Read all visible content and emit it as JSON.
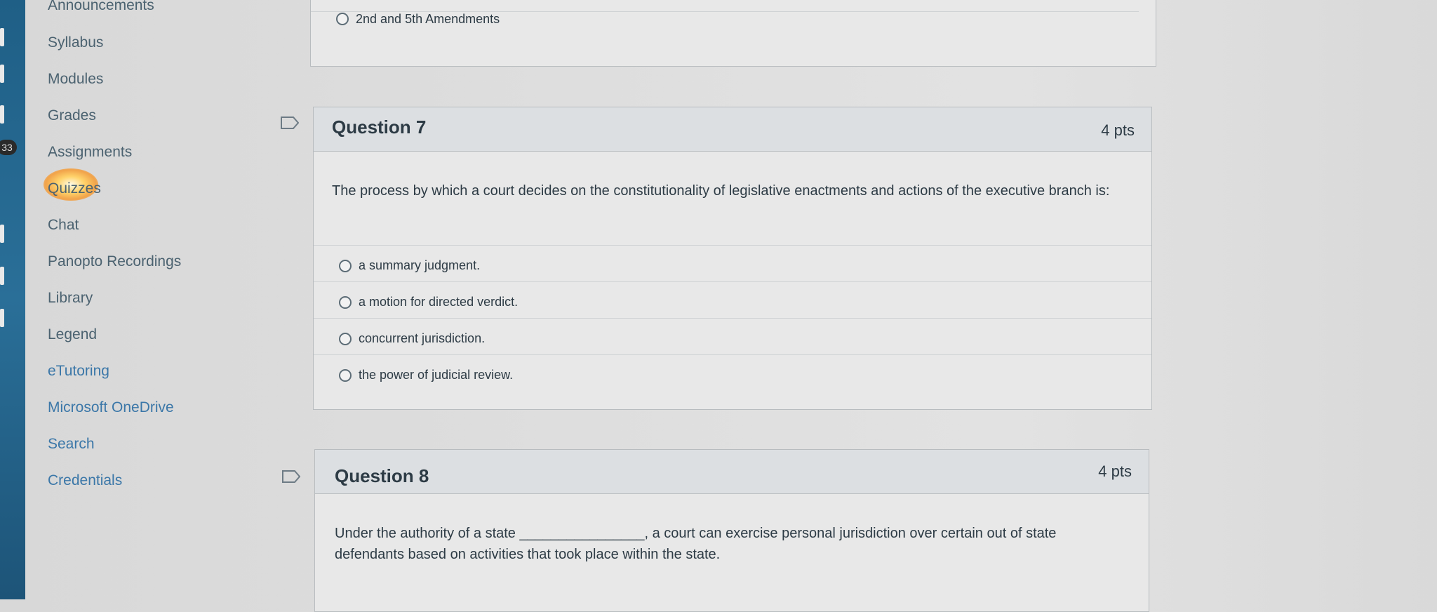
{
  "global_nav": {
    "badge": "33"
  },
  "course_nav": {
    "items": [
      {
        "label": "Announcements"
      },
      {
        "label": "Syllabus"
      },
      {
        "label": "Modules"
      },
      {
        "label": "Grades"
      },
      {
        "label": "Assignments"
      },
      {
        "label": "Quizzes"
      },
      {
        "label": "Chat"
      },
      {
        "label": "Panopto Recordings"
      },
      {
        "label": "Library"
      },
      {
        "label": "Legend"
      },
      {
        "label": "eTutoring"
      },
      {
        "label": "Microsoft OneDrive"
      },
      {
        "label": "Search"
      },
      {
        "label": "Credentials"
      }
    ]
  },
  "question6": {
    "last_answer": "2nd and 5th Amendments"
  },
  "question7": {
    "title": "Question 7",
    "points": "4 pts",
    "text": "The process by which a court decides on the constitutionality of legislative enactments and actions of the executive branch is:",
    "answers": [
      {
        "label": "a summary judgment."
      },
      {
        "label": "a motion for directed verdict."
      },
      {
        "label": "concurrent jurisdiction."
      },
      {
        "label": "the power of judicial review."
      }
    ]
  },
  "question8": {
    "title": "Question 8",
    "points": "4 pts",
    "text_before": "Under the authority of a state",
    "blank": "________________",
    "text_after": ", a court can exercise personal jurisdiction over certain out of state defendants based on activities that took place within the state."
  }
}
